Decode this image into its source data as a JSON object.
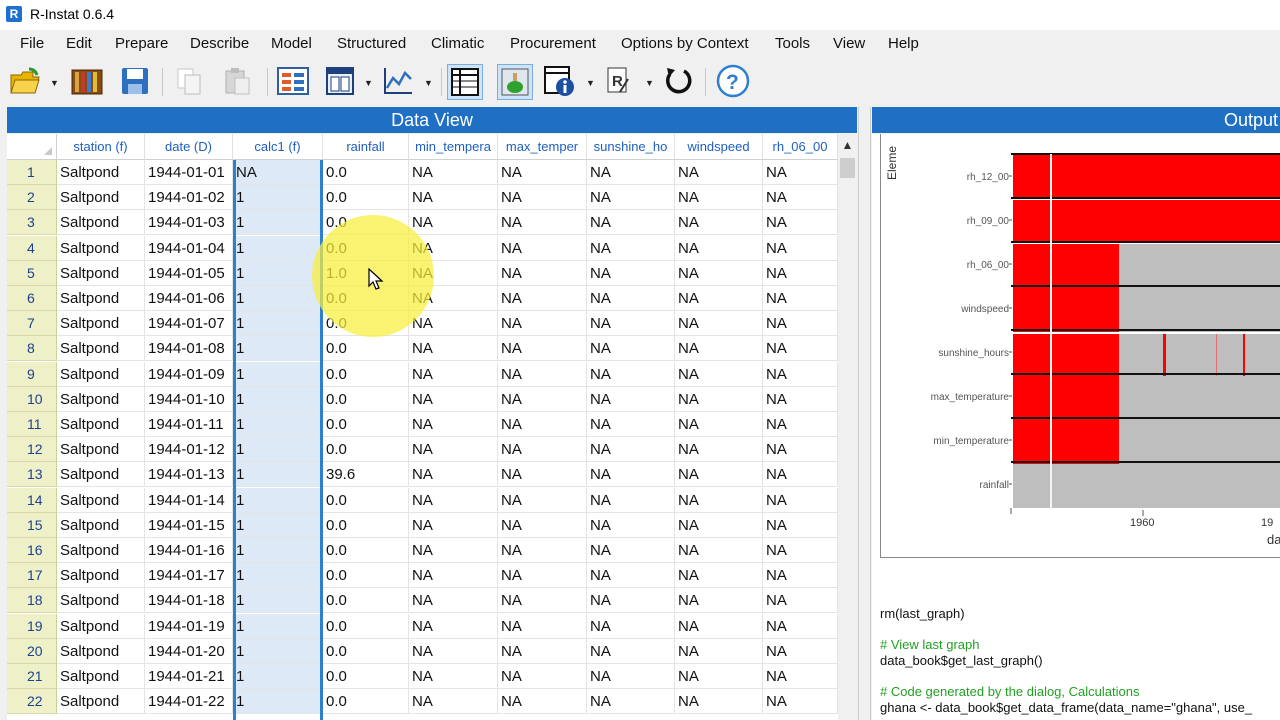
{
  "window": {
    "title": "R-Instat 0.6.4",
    "app_icon": "R"
  },
  "menu": [
    "File",
    "Edit",
    "Prepare",
    "Describe",
    "Model",
    "Structured",
    "Climatic",
    "Procurement",
    "Options by Context",
    "Tools",
    "View",
    "Help"
  ],
  "toolbar": {
    "icons": [
      "open-folder-icon",
      "library-books-icon",
      "save-icon",
      "copy-icon",
      "paste-icon",
      "data-frame-view-icon",
      "column-metadata-icon",
      "graph-icon",
      "data-view-grid-icon",
      "output-window-icon",
      "info-metadata-icon",
      "r-script-icon",
      "undo-refresh-icon",
      "help-icon"
    ],
    "active": [
      "data-view-grid-icon",
      "output-window-icon"
    ]
  },
  "data_view": {
    "title": "Data View",
    "columns": [
      "station (f)",
      "date (D)",
      "calc1 (f)",
      "rainfall",
      "min_tempera",
      "max_temper",
      "sunshine_ho",
      "windspeed",
      "rh_06_00"
    ],
    "rows": [
      [
        "1",
        "Saltpond",
        "1944-01-01",
        "NA",
        "0.0",
        "NA",
        "NA",
        "NA",
        "NA",
        "NA"
      ],
      [
        "2",
        "Saltpond",
        "1944-01-02",
        "1",
        "0.0",
        "NA",
        "NA",
        "NA",
        "NA",
        "NA"
      ],
      [
        "3",
        "Saltpond",
        "1944-01-03",
        "1",
        "0.0",
        "NA",
        "NA",
        "NA",
        "NA",
        "NA"
      ],
      [
        "4",
        "Saltpond",
        "1944-01-04",
        "1",
        "0.0",
        "NA",
        "NA",
        "NA",
        "NA",
        "NA"
      ],
      [
        "5",
        "Saltpond",
        "1944-01-05",
        "1",
        "1.0",
        "NA",
        "NA",
        "NA",
        "NA",
        "NA"
      ],
      [
        "6",
        "Saltpond",
        "1944-01-06",
        "1",
        "0.0",
        "NA",
        "NA",
        "NA",
        "NA",
        "NA"
      ],
      [
        "7",
        "Saltpond",
        "1944-01-07",
        "1",
        "0.0",
        "NA",
        "NA",
        "NA",
        "NA",
        "NA"
      ],
      [
        "8",
        "Saltpond",
        "1944-01-08",
        "1",
        "0.0",
        "NA",
        "NA",
        "NA",
        "NA",
        "NA"
      ],
      [
        "9",
        "Saltpond",
        "1944-01-09",
        "1",
        "0.0",
        "NA",
        "NA",
        "NA",
        "NA",
        "NA"
      ],
      [
        "10",
        "Saltpond",
        "1944-01-10",
        "1",
        "0.0",
        "NA",
        "NA",
        "NA",
        "NA",
        "NA"
      ],
      [
        "11",
        "Saltpond",
        "1944-01-11",
        "1",
        "0.0",
        "NA",
        "NA",
        "NA",
        "NA",
        "NA"
      ],
      [
        "12",
        "Saltpond",
        "1944-01-12",
        "1",
        "0.0",
        "NA",
        "NA",
        "NA",
        "NA",
        "NA"
      ],
      [
        "13",
        "Saltpond",
        "1944-01-13",
        "1",
        "39.6",
        "NA",
        "NA",
        "NA",
        "NA",
        "NA"
      ],
      [
        "14",
        "Saltpond",
        "1944-01-14",
        "1",
        "0.0",
        "NA",
        "NA",
        "NA",
        "NA",
        "NA"
      ],
      [
        "15",
        "Saltpond",
        "1944-01-15",
        "1",
        "0.0",
        "NA",
        "NA",
        "NA",
        "NA",
        "NA"
      ],
      [
        "16",
        "Saltpond",
        "1944-01-16",
        "1",
        "0.0",
        "NA",
        "NA",
        "NA",
        "NA",
        "NA"
      ],
      [
        "17",
        "Saltpond",
        "1944-01-17",
        "1",
        "0.0",
        "NA",
        "NA",
        "NA",
        "NA",
        "NA"
      ],
      [
        "18",
        "Saltpond",
        "1944-01-18",
        "1",
        "0.0",
        "NA",
        "NA",
        "NA",
        "NA",
        "NA"
      ],
      [
        "19",
        "Saltpond",
        "1944-01-19",
        "1",
        "0.0",
        "NA",
        "NA",
        "NA",
        "NA",
        "NA"
      ],
      [
        "20",
        "Saltpond",
        "1944-01-20",
        "1",
        "0.0",
        "NA",
        "NA",
        "NA",
        "NA",
        "NA"
      ],
      [
        "21",
        "Saltpond",
        "1944-01-21",
        "1",
        "0.0",
        "NA",
        "NA",
        "NA",
        "NA",
        "NA"
      ],
      [
        "22",
        "Saltpond",
        "1944-01-22",
        "1",
        "0.0",
        "NA",
        "NA",
        "NA",
        "NA",
        "NA"
      ]
    ],
    "selected_column": "calc1 (f)",
    "colors": {
      "header_bar": "#1f6fc5",
      "row_number_bg": "#eef0c8",
      "selected_col_bg": "#dde9f6",
      "selected_col_border": "#2f7fd0",
      "column_header_text": "#1f5fbf"
    }
  },
  "output": {
    "title": "Output",
    "plot": {
      "y_axis_title": "Eleme",
      "y_labels": [
        "rh_12_00",
        "rh_09_00",
        "rh_06_00",
        "windspeed",
        "sunshine_hours",
        "max_temperature",
        "min_temperature",
        "rainfall"
      ],
      "x_tick_labels": [
        "1960",
        "19"
      ],
      "x_axis_title_partial": "da",
      "colors": {
        "missing": "#ff0000",
        "present": "#bebebe"
      }
    },
    "code_lines": [
      {
        "text": "rm(last_graph)",
        "type": "code"
      },
      {
        "text": "# View last graph",
        "type": "comment"
      },
      {
        "text": "data_book$get_last_graph()",
        "type": "code"
      },
      {
        "text": "# Code generated by the dialog, Calculations",
        "type": "comment"
      },
      {
        "text": "ghana <- data_book$get_data_frame(data_name=\"ghana\", use_",
        "type": "code"
      }
    ]
  }
}
